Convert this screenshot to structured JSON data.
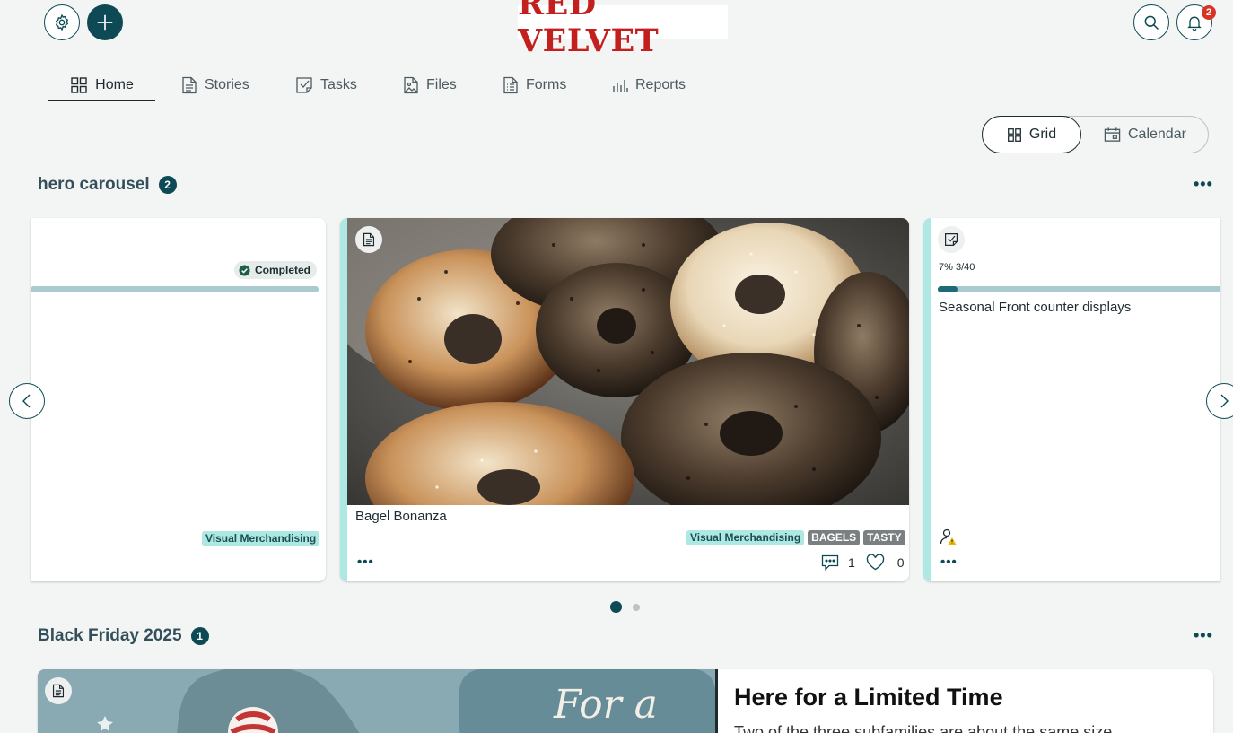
{
  "header": {
    "brand": "RED VELVET",
    "notification_count": "2"
  },
  "tabs": [
    {
      "label": "Home",
      "icon": "grid-icon",
      "active": true
    },
    {
      "label": "Stories",
      "icon": "document-icon"
    },
    {
      "label": "Tasks",
      "icon": "task-check-icon"
    },
    {
      "label": "Files",
      "icon": "image-file-icon"
    },
    {
      "label": "Forms",
      "icon": "form-icon"
    },
    {
      "label": "Reports",
      "icon": "bar-chart-icon"
    }
  ],
  "view_toggle": {
    "grid_label": "Grid",
    "calendar_label": "Calendar",
    "active": "grid"
  },
  "hero_section": {
    "title": "hero carousel",
    "count": "2",
    "page_indicator": {
      "current": 1,
      "total": 2
    },
    "cards": [
      {
        "status": "Completed",
        "progress": 1.0,
        "tags": [
          "Visual Merchandising"
        ]
      },
      {
        "type_icon": "document-icon",
        "title": "Bagel Bonanza",
        "tags": [
          "Visual Merchandising",
          "BAGELS",
          "TASTY"
        ],
        "comments": "1",
        "likes": "0"
      },
      {
        "type_icon": "task-check-icon",
        "progress_text": "7% 3/40",
        "progress": 0.07,
        "title": "Seasonal Front counter displays",
        "assignee_icon": "user-warning-icon"
      }
    ]
  },
  "black_friday_section": {
    "title": "Black Friday 2025",
    "count": "1",
    "card": {
      "type_icon": "document-icon",
      "image_text": "For a",
      "heading": "Here for a Limited Time",
      "body": "Two of the three subfamilies are about the same size"
    }
  },
  "colors": {
    "primary": "#0d4a55",
    "accent": "#aee8e3",
    "brand_red": "#c31f1f",
    "notification": "#d93326"
  }
}
